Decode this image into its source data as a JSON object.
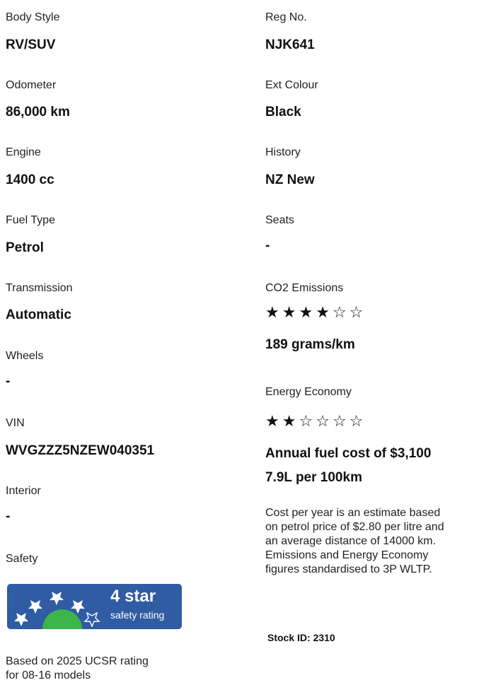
{
  "left": {
    "body_style": {
      "label": "Body Style",
      "value": "RV/SUV"
    },
    "odometer": {
      "label": "Odometer",
      "value": "86,000 km"
    },
    "engine": {
      "label": "Engine",
      "value": "1400 cc"
    },
    "fuel_type": {
      "label": "Fuel Type",
      "value": "Petrol"
    },
    "transmission": {
      "label": "Transmission",
      "value": "Automatic"
    },
    "wheels": {
      "label": "Wheels",
      "value": "-"
    },
    "vin": {
      "label": "VIN",
      "value": "WVGZZZ5NZEW040351"
    },
    "interior": {
      "label": "Interior",
      "value": "-"
    },
    "safety": {
      "label": "Safety",
      "badge_title": "4 star",
      "badge_subtitle": "safety rating",
      "rating_stars": 4,
      "note_line1": "Based on 2025 UCSR rating",
      "note_line2": "for 08-16 models"
    }
  },
  "right": {
    "reg_no": {
      "label": "Reg No.",
      "value": "NJK641"
    },
    "ext_colour": {
      "label": "Ext Colour",
      "value": "Black"
    },
    "history": {
      "label": "History",
      "value": "NZ New"
    },
    "seats": {
      "label": "Seats",
      "value": "-"
    },
    "co2": {
      "label": "CO2 Emissions",
      "stars_filled": 4,
      "stars_total": 6,
      "value": "189 grams/km"
    },
    "energy": {
      "label": "Energy Economy",
      "stars_filled": 2,
      "stars_total": 6
    },
    "annual_cost": "Annual fuel cost of $3,100",
    "consumption": "7.9L per 100km",
    "note_lines": [
      "Cost per year is an estimate based",
      "on petrol price of  $2.80 per litre and",
      "an average distance of 14000 km.",
      "Emissions and Energy Economy",
      "figures standardised to 3P WLTP."
    ],
    "stock_id": "Stock ID: 2310"
  },
  "colors": {
    "badge_blue": "#2f5ca3",
    "badge_green": "#3db54a"
  }
}
